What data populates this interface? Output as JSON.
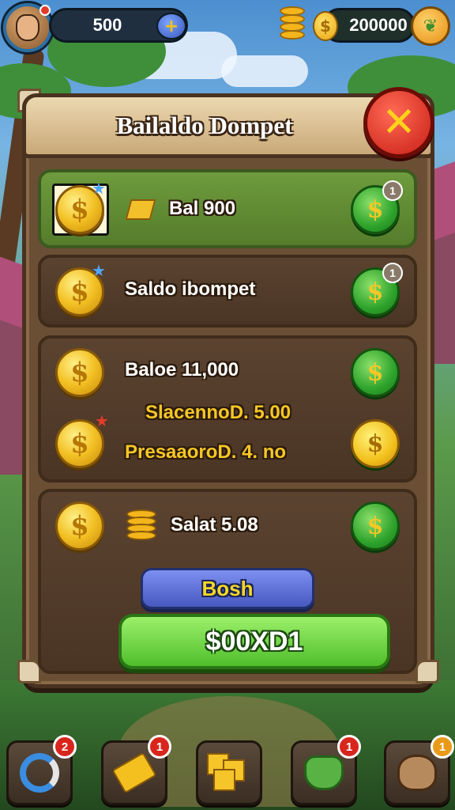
{
  "hud": {
    "currency_left": "500",
    "currency_right": "200000",
    "plus_icon": "plus-icon",
    "coin_symbol": "$"
  },
  "panel": {
    "title": "Bailaldo Dompet",
    "close_icon": "close-icon"
  },
  "rows": [
    {
      "label": "Bal 900",
      "button_symbol": "$",
      "badge": "1"
    },
    {
      "label": "Saldo ibompet",
      "button_symbol": "$",
      "badge": "1"
    },
    {
      "label": "Baloe 11,000",
      "button_symbol": "$"
    },
    {
      "label": "SlacennoD. 5.00",
      "button_symbol": "$"
    },
    {
      "label": "PresaaoroD. 4. no",
      "button_symbol": "$"
    },
    {
      "label": "Salat 5.08",
      "button_symbol": "$"
    }
  ],
  "coin_symbol": "$",
  "buttons": {
    "boost_label": "Bosh",
    "main_label": "$00XD1"
  },
  "nav": [
    {
      "name": "refresh",
      "badge": "2"
    },
    {
      "name": "gold-bar",
      "badge": "1"
    },
    {
      "name": "blocks",
      "badge": ""
    },
    {
      "name": "gem",
      "badge": "1"
    },
    {
      "name": "pet",
      "badge": "1"
    }
  ],
  "colors": {
    "panel_wood": "#6a4f34",
    "accent_green": "#4fbe2c",
    "close_red": "#c81d14",
    "gold": "#f5c726",
    "boost_blue": "#4759c0"
  }
}
